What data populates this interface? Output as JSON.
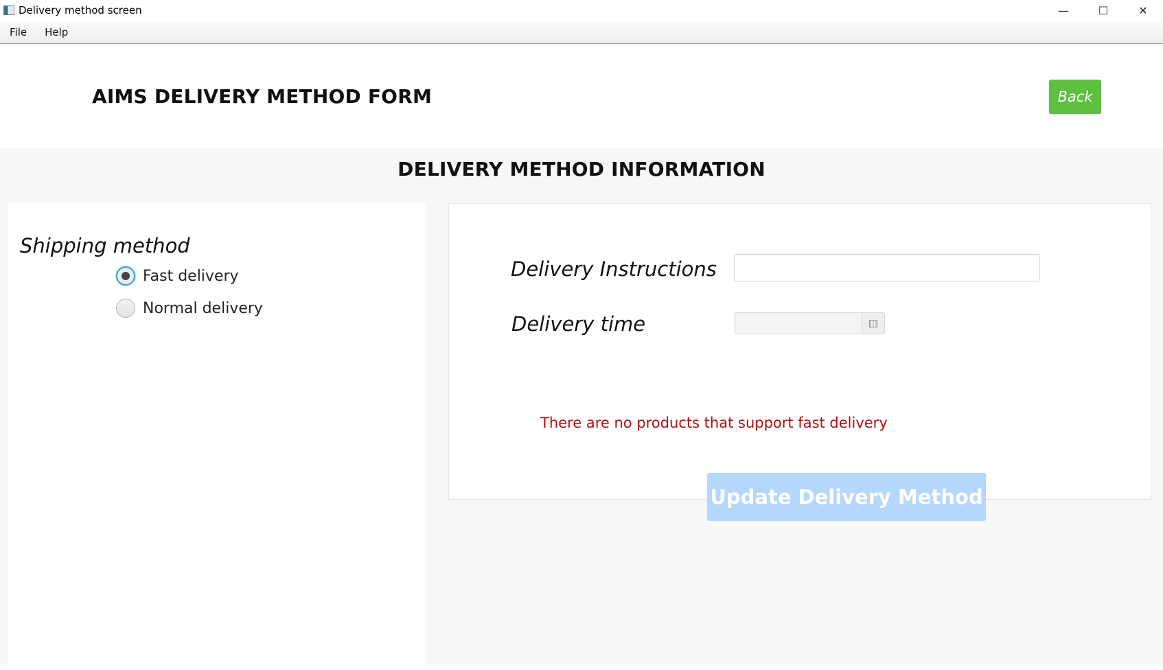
{
  "window": {
    "title": "Delivery method screen",
    "controls": {
      "minimize": "—",
      "maximize": "☐",
      "close": "✕"
    }
  },
  "menu": {
    "items": [
      "File",
      "Help"
    ]
  },
  "header": {
    "title": "AIMS DELIVERY METHOD FORM",
    "back_label": "Back",
    "back_color": "#5cbf3e"
  },
  "content": {
    "section_title": "DELIVERY METHOD INFORMATION",
    "shipping": {
      "label": "Shipping method",
      "options": [
        {
          "label": "Fast delivery",
          "selected": true
        },
        {
          "label": "Normal delivery",
          "selected": false
        }
      ]
    },
    "form": {
      "instructions_label": "Delivery Instructions",
      "instructions_value": "",
      "time_label": "Delivery time",
      "time_value": "",
      "error_message": "There are no products that support fast delivery",
      "error_color": "#b30e0e",
      "update_label": "Update Delivery Method",
      "update_color": "#b3d8fb"
    }
  }
}
